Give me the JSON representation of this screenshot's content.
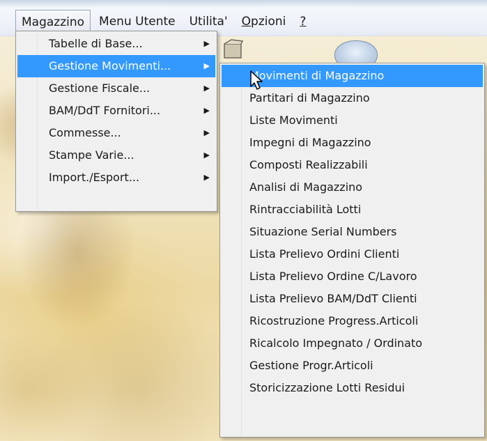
{
  "menubar": {
    "items": [
      "Magazzino",
      "Menu Utente",
      "Utilita'"
    ],
    "opzioni_first": "O",
    "opzioni_rest": "pzioni",
    "help": "?"
  },
  "magazzino_menu": {
    "items": [
      "Tabelle di Base...",
      "Gestione Movimenti...",
      "Gestione Fiscale...",
      "BAM/DdT Fornitori...",
      "Commesse...",
      "Stampe Varie...",
      "Import./Esport..."
    ],
    "active_index": 1,
    "submenu_arrow": "▶"
  },
  "movimenti_submenu": {
    "items": [
      "Movimenti di Magazzino",
      "Partitari di Magazzino",
      "Liste Movimenti",
      "Impegni di Magazzino",
      "Composti Realizzabili",
      "Analisi di Magazzino",
      "Rintracciabilità Lotti",
      "Situazione Serial Numbers",
      "Lista Prelievo Ordini Clienti",
      "Lista Prelievo Ordine C/Lavoro",
      "Lista Prelievo BAM/DdT Clienti",
      "Ricostruzione Progress.Articoli",
      "Ricalcolo Impegnato / Ordinato",
      "Gestione Progr.Articoli",
      "Storicizzazione Lotti Residui"
    ],
    "active_index": 0
  },
  "colors": {
    "highlight": "#3399ff",
    "menu_bg": "#f0f0f0",
    "menu_border": "#979797"
  }
}
